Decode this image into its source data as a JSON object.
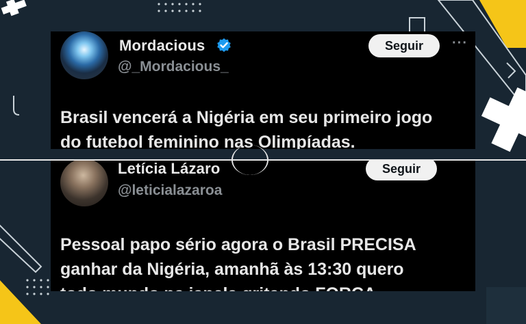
{
  "colors": {
    "background": "#182632",
    "card": "#000000",
    "accent_yellow": "#f5c518",
    "verified_blue": "#1d9bf0",
    "text": "#e7e7e7",
    "muted": "#8a8f94"
  },
  "tweets": [
    {
      "name": "Mordacious",
      "handle": "@_Mordacious_",
      "verified": true,
      "follow_label": "Seguir",
      "more_icon": "more-dots-icon",
      "text_lines": [
        "Brasil vencerá a Nigéria em seu primeiro jogo",
        "do futebol feminino nas Olimpíadas."
      ]
    },
    {
      "name": "Letícia Lázaro",
      "handle": "@leticialazaroa",
      "verified": false,
      "follow_label": "Seguir",
      "text_lines": [
        "Pessoal papo sério agora o Brasil PRECISA",
        "ganhar da Nigéria, amanhã às 13:30 quero",
        "todo mundo na janela gritando FORÇA"
      ]
    }
  ]
}
